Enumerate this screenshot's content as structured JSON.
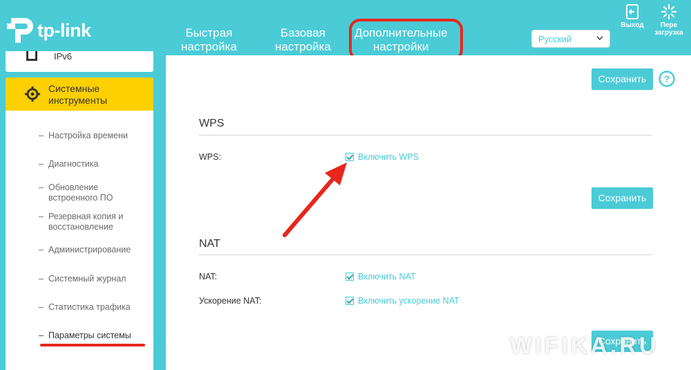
{
  "header": {
    "brand": "tp-link",
    "tabs": [
      {
        "line1": "Быстрая",
        "line2": "настройка"
      },
      {
        "line1": "Базовая",
        "line2": "настройка"
      },
      {
        "line1": "Дополнительные",
        "line2": "настройки"
      }
    ],
    "language": "Русский",
    "logout_label": "Выход",
    "reboot_label_1": "Пере",
    "reboot_label_2": "загрузка"
  },
  "sidebar": {
    "ipv6": "IPv6",
    "tools_line1": "Системные",
    "tools_line2": "инструменты",
    "items": [
      {
        "line1": "Настройка времени",
        "line2": ""
      },
      {
        "line1": "Диагностика",
        "line2": ""
      },
      {
        "line1": "Обновление",
        "line2": "встроенного ПО"
      },
      {
        "line1": "Резервная копия и",
        "line2": "восстановление"
      },
      {
        "line1": "Администрирование",
        "line2": ""
      },
      {
        "line1": "Системный журнал",
        "line2": ""
      },
      {
        "line1": "Статистика трафика",
        "line2": ""
      },
      {
        "line1": "Параметры системы",
        "line2": ""
      }
    ]
  },
  "main": {
    "save_label": "Сохранить",
    "wps": {
      "title": "WPS",
      "field_label": "WPS:",
      "checkbox_label": "Включить WPS"
    },
    "nat": {
      "title": "NAT",
      "nat_label": "NAT:",
      "nat_checkbox": "Включить NAT",
      "accel_label": "Ускорение NAT:",
      "accel_checkbox": "Включить ускорение NAT"
    }
  },
  "watermark": "WIFIKA.RU",
  "colors": {
    "accent": "#4acbd6",
    "active_menu": "#ffd000",
    "annotation_red": "#e8261c"
  }
}
